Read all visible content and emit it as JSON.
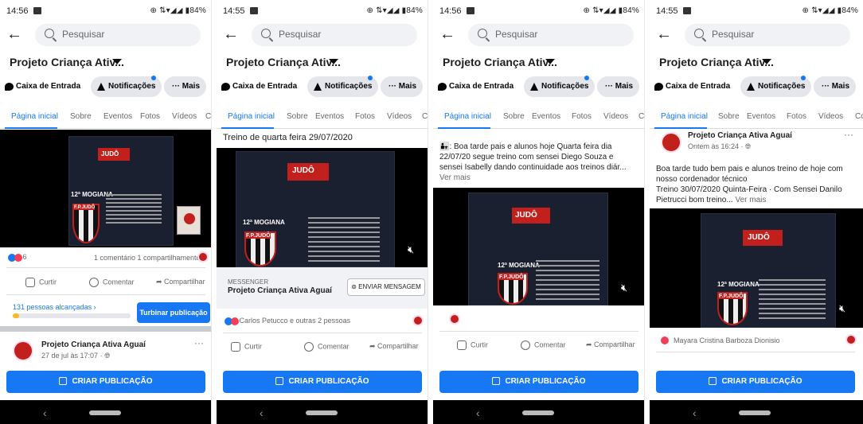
{
  "common": {
    "search_placeholder": "Pesquisar",
    "page_title": "Projeto Criança Ativ...",
    "inbox_label": "Caixa de Entrada",
    "notifications_label": "Notificações",
    "more_label": "Mais",
    "tabs": [
      "Página inicial",
      "Sobre",
      "Eventos",
      "Fotos",
      "Vídeos",
      "Co"
    ],
    "create_post_label": "CRIAR PUBLICAÇÃO",
    "like_label": "Curtir",
    "comment_label": "Comentar",
    "share_label": "Compartilhar",
    "battery": "84%",
    "poster_title": "12ª MOGIANA",
    "poster_club": "F.P.JUDÔ",
    "poster_logo": "JUDÔ"
  },
  "screens": [
    {
      "time": "14:56",
      "reaction_count": "6",
      "comment_share": "1 comentário 1 compartilhamento",
      "reach": "131 pessoas alcançadas",
      "boost_label": "Turbinar publicação",
      "next_post_author": "Projeto Criança Ativa Aguaí",
      "next_post_time": "27 de jul às 17:07",
      "colors": {
        "like": "#1877f2",
        "love": "#f33e58",
        "accent": "#1877f2"
      }
    },
    {
      "time": "14:55",
      "caption": "Treino de quarta feira 29/07/2020",
      "messenger_label": "MESSENGER",
      "messenger_page": "Projeto Criança Ativa Aguaí",
      "send_message_label": "ENVIAR MENSAGEM",
      "reactors": "Carlos Petucco e outras 2 pessoas"
    },
    {
      "time": "14:56",
      "post_text": ": Boa tarde pais e alunos hoje Quarta feira dia 22/07/20 segue treino com sensei Diego Souza e sensei Isabelly dando continuidade aos treinos diár...",
      "see_more": "Ver mais"
    },
    {
      "time": "14:55",
      "author": "Projeto Criança Ativa Aguaí",
      "post_time": "Ontem às 16:24",
      "post_text_1": "Boa tarde tudo bem pais e alunos treino de hoje com nosso cordenador técnico",
      "post_text_2": "Treino 30/07/2020 Quinta-Feira · Com Sensei Danilo Pietrucci bom treino...",
      "see_more": "Ver mais",
      "reactor": "Mayara Cristina Barboza Dionisio"
    }
  ]
}
